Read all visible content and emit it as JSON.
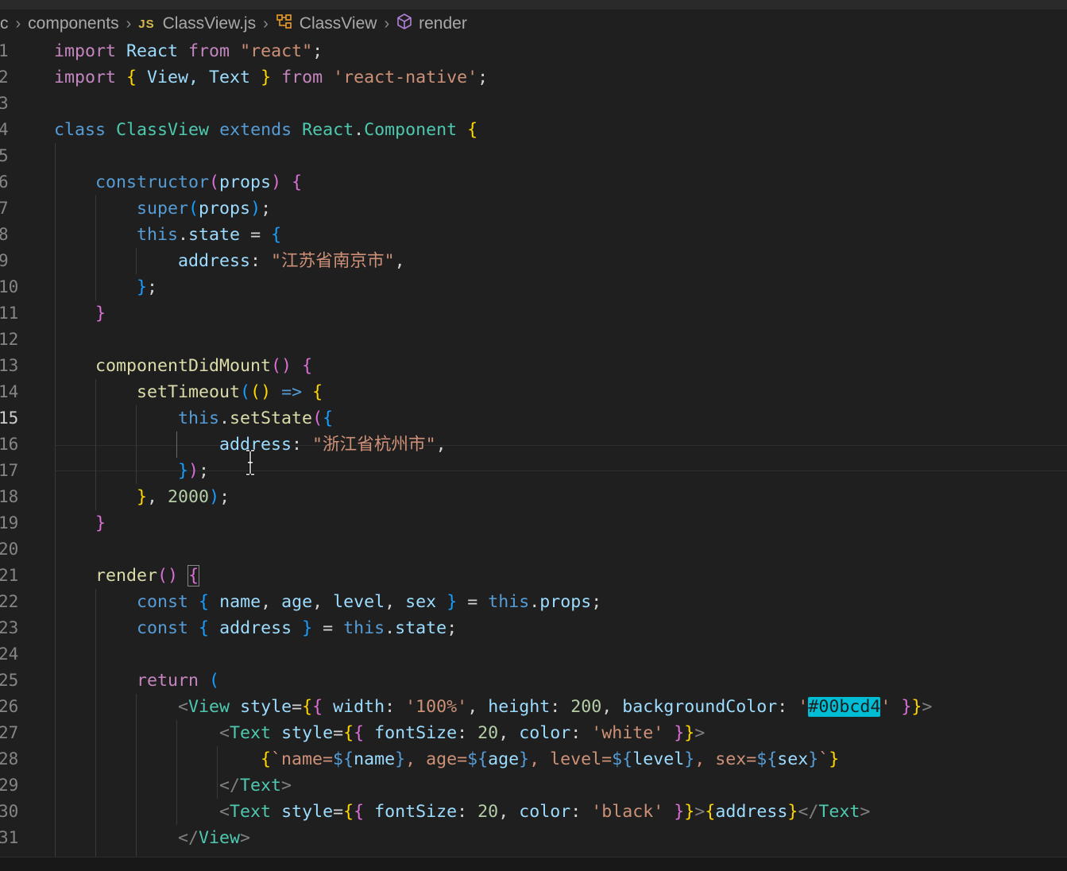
{
  "breadcrumb": {
    "items": [
      {
        "label": "c",
        "icon": ""
      },
      {
        "label": "components",
        "icon": ""
      },
      {
        "label": "ClassView.js",
        "icon": "js-file-icon",
        "icon_text": "JS"
      },
      {
        "label": "ClassView",
        "icon": "class-icon"
      },
      {
        "label": "render",
        "icon": "method-icon"
      }
    ]
  },
  "editor": {
    "active_line": 15,
    "lines": [
      {
        "n": "1",
        "tokens": [
          [
            "import",
            "kw"
          ],
          [
            " React ",
            "id"
          ],
          [
            "from",
            "kw"
          ],
          [
            " ",
            "p"
          ],
          [
            "\"react\"",
            "str"
          ],
          [
            ";",
            "p"
          ]
        ]
      },
      {
        "n": "2",
        "tokens": [
          [
            "import",
            "kw"
          ],
          [
            " ",
            "p"
          ],
          [
            "{",
            "b1"
          ],
          [
            " View, Text ",
            "id"
          ],
          [
            "}",
            "b1"
          ],
          [
            " ",
            "p"
          ],
          [
            "from",
            "kw"
          ],
          [
            " ",
            "p"
          ],
          [
            "'react-native'",
            "str"
          ],
          [
            ";",
            "p"
          ]
        ]
      },
      {
        "n": "3",
        "tokens": []
      },
      {
        "n": "4",
        "tokens": [
          [
            "class",
            "st"
          ],
          [
            " ",
            "p"
          ],
          [
            "ClassView",
            "cls"
          ],
          [
            " ",
            "p"
          ],
          [
            "extends",
            "st"
          ],
          [
            " ",
            "p"
          ],
          [
            "React",
            "cls"
          ],
          [
            ".",
            "p"
          ],
          [
            "Component",
            "cls"
          ],
          [
            " ",
            "p"
          ],
          [
            "{",
            "b1"
          ]
        ]
      },
      {
        "n": "5",
        "tokens": []
      },
      {
        "n": "6",
        "tokens": [
          [
            "    ",
            "p"
          ],
          [
            "constructor",
            "st"
          ],
          [
            "(",
            "b2"
          ],
          [
            "props",
            "id"
          ],
          [
            ")",
            "b2"
          ],
          [
            " ",
            "p"
          ],
          [
            "{",
            "b2"
          ]
        ]
      },
      {
        "n": "7",
        "tokens": [
          [
            "        ",
            "p"
          ],
          [
            "super",
            "st"
          ],
          [
            "(",
            "b3"
          ],
          [
            "props",
            "id"
          ],
          [
            ")",
            "b3"
          ],
          [
            ";",
            "p"
          ]
        ]
      },
      {
        "n": "8",
        "tokens": [
          [
            "        ",
            "p"
          ],
          [
            "this",
            "st"
          ],
          [
            ".",
            "p"
          ],
          [
            "state",
            "id"
          ],
          [
            " = ",
            "p"
          ],
          [
            "{",
            "b3"
          ]
        ]
      },
      {
        "n": "9",
        "tokens": [
          [
            "            ",
            "p"
          ],
          [
            "address",
            "id"
          ],
          [
            ": ",
            "p"
          ],
          [
            "\"江苏省南京市\"",
            "str"
          ],
          [
            ",",
            "p"
          ]
        ]
      },
      {
        "n": "10",
        "tokens": [
          [
            "        ",
            "p"
          ],
          [
            "}",
            "b3"
          ],
          [
            ";",
            "p"
          ]
        ]
      },
      {
        "n": "11",
        "tokens": [
          [
            "    ",
            "p"
          ],
          [
            "}",
            "b2"
          ]
        ]
      },
      {
        "n": "12",
        "tokens": []
      },
      {
        "n": "13",
        "tokens": [
          [
            "    ",
            "p"
          ],
          [
            "componentDidMount",
            "fn"
          ],
          [
            "(",
            "b2"
          ],
          [
            ")",
            "b2"
          ],
          [
            " ",
            "p"
          ],
          [
            "{",
            "b2"
          ]
        ]
      },
      {
        "n": "14",
        "tokens": [
          [
            "        ",
            "p"
          ],
          [
            "setTimeout",
            "fn"
          ],
          [
            "(",
            "b3"
          ],
          [
            "(",
            "b1"
          ],
          [
            ")",
            "b1"
          ],
          [
            " ",
            "p"
          ],
          [
            "=>",
            "st"
          ],
          [
            " ",
            "p"
          ],
          [
            "{",
            "b1"
          ]
        ]
      },
      {
        "n": "15",
        "tokens": [
          [
            "            ",
            "p"
          ],
          [
            "this",
            "st"
          ],
          [
            ".",
            "p"
          ],
          [
            "setState",
            "fn"
          ],
          [
            "(",
            "b2"
          ],
          [
            "{",
            "b3"
          ]
        ]
      },
      {
        "n": "16",
        "tokens": [
          [
            "                ",
            "p"
          ],
          [
            "address",
            "id"
          ],
          [
            ": ",
            "p"
          ],
          [
            "\"浙江省杭州市\"",
            "str"
          ],
          [
            ",",
            "p"
          ]
        ]
      },
      {
        "n": "17",
        "tokens": [
          [
            "            ",
            "p"
          ],
          [
            "}",
            "b3"
          ],
          [
            ")",
            "b2"
          ],
          [
            ";",
            "p"
          ]
        ]
      },
      {
        "n": "18",
        "tokens": [
          [
            "        ",
            "p"
          ],
          [
            "}",
            "b1"
          ],
          [
            ", ",
            "p"
          ],
          [
            "2000",
            "num"
          ],
          [
            ")",
            "b3"
          ],
          [
            ";",
            "p"
          ]
        ]
      },
      {
        "n": "19",
        "tokens": [
          [
            "    ",
            "p"
          ],
          [
            "}",
            "b2"
          ]
        ]
      },
      {
        "n": "20",
        "tokens": []
      },
      {
        "n": "21",
        "tokens": [
          [
            "    ",
            "p"
          ],
          [
            "render",
            "fn"
          ],
          [
            "(",
            "b2"
          ],
          [
            ")",
            "b2"
          ],
          [
            " ",
            "p"
          ],
          [
            "{",
            "b2bm"
          ]
        ]
      },
      {
        "n": "22",
        "tokens": [
          [
            "        ",
            "p"
          ],
          [
            "const",
            "st"
          ],
          [
            " ",
            "p"
          ],
          [
            "{",
            "b3"
          ],
          [
            " ",
            "p"
          ],
          [
            "name",
            "id"
          ],
          [
            ", ",
            "p"
          ],
          [
            "age",
            "id"
          ],
          [
            ", ",
            "p"
          ],
          [
            "level",
            "id"
          ],
          [
            ", ",
            "p"
          ],
          [
            "sex",
            "id"
          ],
          [
            " ",
            "p"
          ],
          [
            "}",
            "b3"
          ],
          [
            " = ",
            "p"
          ],
          [
            "this",
            "st"
          ],
          [
            ".",
            "p"
          ],
          [
            "props",
            "id"
          ],
          [
            ";",
            "p"
          ]
        ]
      },
      {
        "n": "23",
        "tokens": [
          [
            "        ",
            "p"
          ],
          [
            "const",
            "st"
          ],
          [
            " ",
            "p"
          ],
          [
            "{",
            "b3"
          ],
          [
            " ",
            "p"
          ],
          [
            "address",
            "id"
          ],
          [
            " ",
            "p"
          ],
          [
            "}",
            "b3"
          ],
          [
            " = ",
            "p"
          ],
          [
            "this",
            "st"
          ],
          [
            ".",
            "p"
          ],
          [
            "state",
            "id"
          ],
          [
            ";",
            "p"
          ]
        ]
      },
      {
        "n": "24",
        "tokens": []
      },
      {
        "n": "25",
        "tokens": [
          [
            "        ",
            "p"
          ],
          [
            "return",
            "kw"
          ],
          [
            " ",
            "p"
          ],
          [
            "(",
            "b3"
          ]
        ]
      },
      {
        "n": "26",
        "tokens": [
          [
            "            ",
            "p"
          ],
          [
            "<",
            "tag"
          ],
          [
            "View",
            "cls"
          ],
          [
            " ",
            "p"
          ],
          [
            "style",
            "id"
          ],
          [
            "=",
            "p"
          ],
          [
            "{",
            "b1"
          ],
          [
            "{",
            "b2"
          ],
          [
            " ",
            "p"
          ],
          [
            "width",
            "id"
          ],
          [
            ": ",
            "p"
          ],
          [
            "'100%'",
            "str"
          ],
          [
            ", ",
            "p"
          ],
          [
            "height",
            "id"
          ],
          [
            ": ",
            "p"
          ],
          [
            "200",
            "num"
          ],
          [
            ", ",
            "p"
          ],
          [
            "backgroundColor",
            "id"
          ],
          [
            ": ",
            "p"
          ],
          [
            "'",
            "str"
          ],
          [
            "#00bcd4",
            "hl"
          ],
          [
            "'",
            "str"
          ],
          [
            " ",
            "p"
          ],
          [
            "}",
            "b2"
          ],
          [
            "}",
            "b1"
          ],
          [
            ">",
            "tag"
          ]
        ]
      },
      {
        "n": "27",
        "tokens": [
          [
            "                ",
            "p"
          ],
          [
            "<",
            "tag"
          ],
          [
            "Text",
            "cls"
          ],
          [
            " ",
            "p"
          ],
          [
            "style",
            "id"
          ],
          [
            "=",
            "p"
          ],
          [
            "{",
            "b1"
          ],
          [
            "{",
            "b2"
          ],
          [
            " ",
            "p"
          ],
          [
            "fontSize",
            "id"
          ],
          [
            ": ",
            "p"
          ],
          [
            "20",
            "num"
          ],
          [
            ", ",
            "p"
          ],
          [
            "color",
            "id"
          ],
          [
            ": ",
            "p"
          ],
          [
            "'white'",
            "str"
          ],
          [
            " ",
            "p"
          ],
          [
            "}",
            "b2"
          ],
          [
            "}",
            "b1"
          ],
          [
            ">",
            "tag"
          ]
        ]
      },
      {
        "n": "28",
        "tokens": [
          [
            "                    ",
            "p"
          ],
          [
            "{",
            "b1"
          ],
          [
            "`name=",
            "str"
          ],
          [
            "${",
            "st"
          ],
          [
            "name",
            "id"
          ],
          [
            "}",
            "st"
          ],
          [
            ", age=",
            "str"
          ],
          [
            "${",
            "st"
          ],
          [
            "age",
            "id"
          ],
          [
            "}",
            "st"
          ],
          [
            ", level=",
            "str"
          ],
          [
            "${",
            "st"
          ],
          [
            "level",
            "id"
          ],
          [
            "}",
            "st"
          ],
          [
            ", sex=",
            "str"
          ],
          [
            "${",
            "st"
          ],
          [
            "sex",
            "id"
          ],
          [
            "}",
            "st"
          ],
          [
            "`",
            "str"
          ],
          [
            "}",
            "b1"
          ]
        ]
      },
      {
        "n": "29",
        "tokens": [
          [
            "                ",
            "p"
          ],
          [
            "</",
            "tag"
          ],
          [
            "Text",
            "cls"
          ],
          [
            ">",
            "tag"
          ]
        ]
      },
      {
        "n": "30",
        "tokens": [
          [
            "                ",
            "p"
          ],
          [
            "<",
            "tag"
          ],
          [
            "Text",
            "cls"
          ],
          [
            " ",
            "p"
          ],
          [
            "style",
            "id"
          ],
          [
            "=",
            "p"
          ],
          [
            "{",
            "b1"
          ],
          [
            "{",
            "b2"
          ],
          [
            " ",
            "p"
          ],
          [
            "fontSize",
            "id"
          ],
          [
            ": ",
            "p"
          ],
          [
            "20",
            "num"
          ],
          [
            ", ",
            "p"
          ],
          [
            "color",
            "id"
          ],
          [
            ": ",
            "p"
          ],
          [
            "'black'",
            "str"
          ],
          [
            " ",
            "p"
          ],
          [
            "}",
            "b2"
          ],
          [
            "}",
            "b1"
          ],
          [
            ">",
            "tag"
          ],
          [
            "{",
            "b1"
          ],
          [
            "address",
            "id"
          ],
          [
            "}",
            "b1"
          ],
          [
            "</",
            "tag"
          ],
          [
            "Text",
            "cls"
          ],
          [
            ">",
            "tag"
          ]
        ]
      },
      {
        "n": "31",
        "tokens": [
          [
            "            ",
            "p"
          ],
          [
            "</",
            "tag"
          ],
          [
            "View",
            "cls"
          ],
          [
            ">",
            "tag"
          ]
        ]
      }
    ]
  },
  "colors": {
    "background": "#1f1f1f",
    "keyword_control": "#c586c0",
    "keyword_storage": "#569cd6",
    "identifier": "#9cdcfe",
    "class_name": "#4ec9b0",
    "function": "#dcdcaa",
    "string": "#ce9178",
    "number": "#b5cea8",
    "color_swatch_highlight": "#00bcd4"
  }
}
